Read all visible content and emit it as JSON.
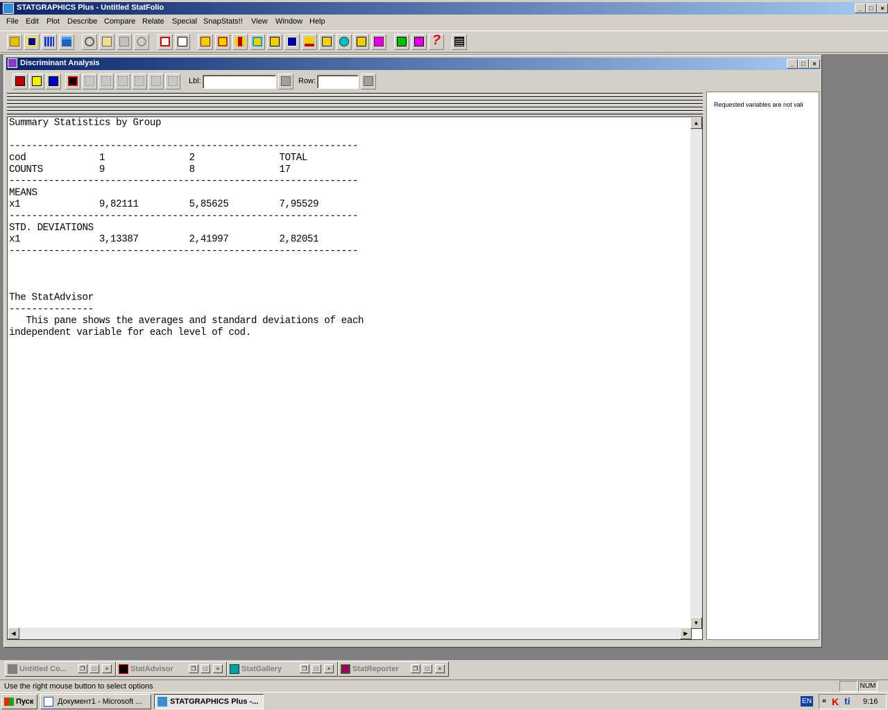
{
  "app": {
    "title": "STATGRAPHICS Plus - Untitled StatFolio"
  },
  "menu": [
    "File",
    "Edit",
    "Plot",
    "Describe",
    "Compare",
    "Relate",
    "Special",
    "SnapStats!!",
    "View",
    "Window",
    "Help"
  ],
  "child": {
    "title": "Discriminant Analysis",
    "lbl_label": "Lbl:",
    "row_label": "Row:",
    "lbl_value": "",
    "row_value": ""
  },
  "report": {
    "lines": [
      "Summary Statistics by Group",
      "",
      "--------------------------------------------------------------",
      "cod             1               2               TOTAL",
      "COUNTS          9               8               17",
      "--------------------------------------------------------------",
      "MEANS",
      "x1              9,82111         5,85625         7,95529",
      "--------------------------------------------------------------",
      "STD. DEVIATIONS",
      "x1              3,13387         2,41997         2,82051",
      "--------------------------------------------------------------",
      "",
      "",
      "",
      "The StatAdvisor",
      "---------------",
      "   This pane shows the averages and standard deviations of each",
      "independent variable for each level of cod."
    ]
  },
  "right_pane": {
    "message": "Requested variables are not vali"
  },
  "minimized_windows": [
    {
      "label": "Untitled Co...",
      "icon_color": "#808080"
    },
    {
      "label": "StatAdvisor",
      "icon_color": "#000000"
    },
    {
      "label": "StatGallery",
      "icon_color": "#00a0a0"
    },
    {
      "label": "StatReporter",
      "icon_color": "#a00060"
    }
  ],
  "status": {
    "message": "Use the right mouse button to select options",
    "num": "NUM"
  },
  "taskbar": {
    "start": "Пуск",
    "items": [
      "Документ1 - Microsoft ...",
      "STATGRAPHICS Plus -..."
    ],
    "lang": "EN",
    "time": "9:16"
  }
}
